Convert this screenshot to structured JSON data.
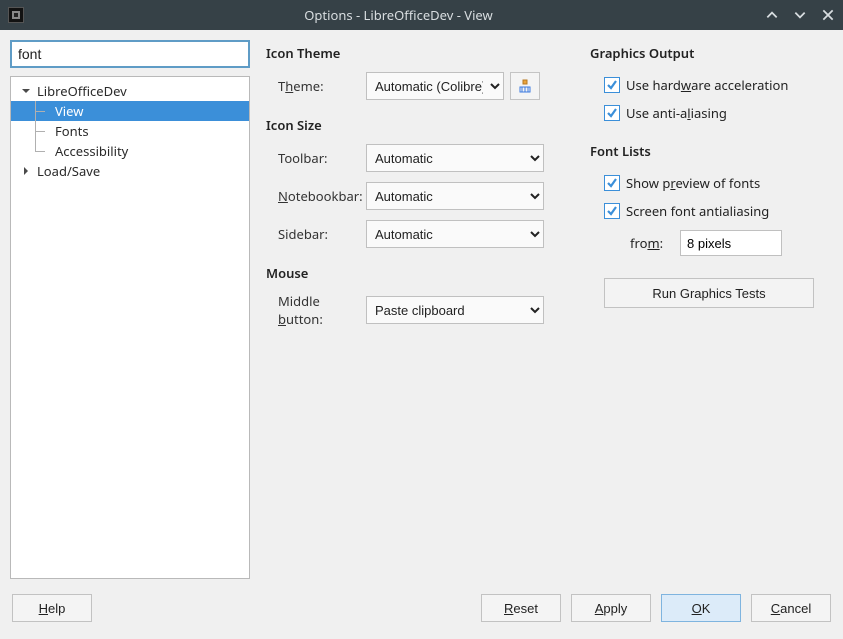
{
  "window": {
    "title": "Options - LibreOfficeDev - View"
  },
  "search": {
    "value": "font"
  },
  "tree": {
    "items": [
      {
        "label": "LibreOfficeDev",
        "depth": 0,
        "expanded": true,
        "hasChildren": true
      },
      {
        "label": "View",
        "depth": 1,
        "selected": true,
        "last": false
      },
      {
        "label": "Fonts",
        "depth": 1,
        "last": false
      },
      {
        "label": "Accessibility",
        "depth": 1,
        "last": true
      },
      {
        "label": "Load/Save",
        "depth": 0,
        "expanded": false,
        "hasChildren": true
      }
    ]
  },
  "sections": {
    "iconTheme": {
      "title": "Icon Theme",
      "themeLabel_pre": "T",
      "themeLabel_u": "h",
      "themeLabel_post": "eme:",
      "themeValue": "Automatic (Colibre)"
    },
    "iconSize": {
      "title": "Icon Size",
      "toolbarLabel": "Toolbar:",
      "toolbarValue": "Automatic",
      "notebookLabel_u": "N",
      "notebookLabel_post": "otebookbar:",
      "notebookValue": "Automatic",
      "sidebarLabel": "Sidebar:",
      "sidebarValue": "Automatic"
    },
    "mouse": {
      "title": "Mouse",
      "middleLabel_pre": "Middle ",
      "middleLabel_u": "b",
      "middleLabel_post": "utton:",
      "middleValue": "Paste clipboard"
    },
    "graphics": {
      "title": "Graphics Output",
      "hw_pre": "Use hard",
      "hw_u": "w",
      "hw_post": "are acceleration",
      "aa_pre": "Use anti-a",
      "aa_u": "l",
      "aa_post": "iasing"
    },
    "fontLists": {
      "title": "Font Lists",
      "preview_pre": "Show p",
      "preview_u": "r",
      "preview_post": "eview of fonts",
      "screen_pre": "Screen font antialiasin",
      "screen_u": "g",
      "from_pre": "fro",
      "from_u": "m",
      "from_post": ":",
      "fromValue": "8 pixels"
    },
    "runTests": "Run Graphics Tests"
  },
  "footer": {
    "help_u": "H",
    "help_post": "elp",
    "reset_u": "R",
    "reset_post": "eset",
    "apply_u": "A",
    "apply_post": "pply",
    "ok_u": "O",
    "ok_post": "K",
    "cancel_u": "C",
    "cancel_post": "ancel"
  }
}
